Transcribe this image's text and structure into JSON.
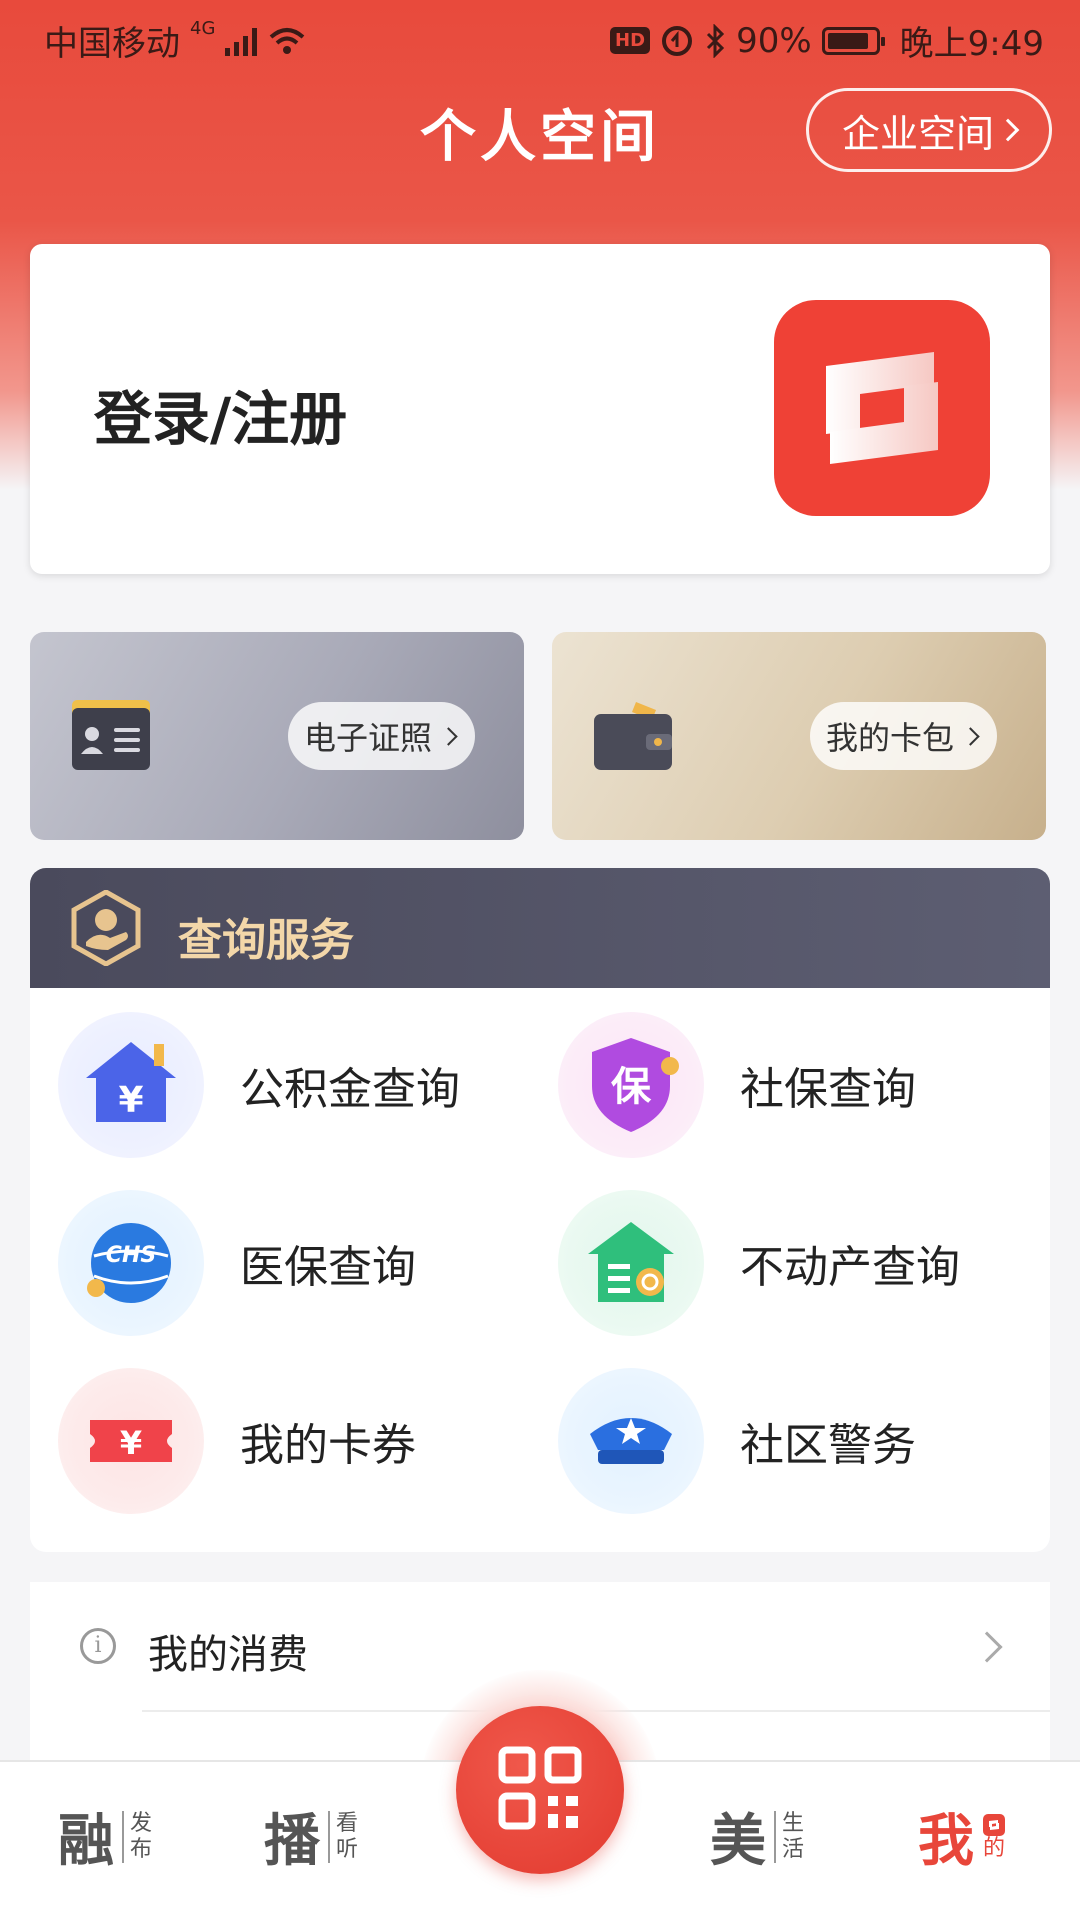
{
  "status_bar": {
    "carrier": "中国移动",
    "network": "4G",
    "battery": "90%",
    "time": "晚上9:49"
  },
  "header": {
    "title": "个人空间",
    "enterprise_button": "企业空间"
  },
  "login": {
    "label": "登录/注册"
  },
  "quick_cards": [
    {
      "label": "电子证照",
      "icon": "id-card-icon"
    },
    {
      "label": "我的卡包",
      "icon": "wallet-icon"
    }
  ],
  "services": {
    "title": "查询服务",
    "items": [
      {
        "label": "公积金查询",
        "icon": "house-yuan-icon"
      },
      {
        "label": "社保查询",
        "icon": "shield-bao-icon",
        "glyph": "保"
      },
      {
        "label": "医保查询",
        "icon": "chs-globe-icon",
        "glyph": "CHS"
      },
      {
        "label": "不动产查询",
        "icon": "property-house-icon"
      },
      {
        "label": "我的卡券",
        "icon": "ticket-yuan-icon",
        "glyph": "¥"
      },
      {
        "label": "社区警务",
        "icon": "police-cap-icon"
      }
    ]
  },
  "list": [
    {
      "label": "我的消费"
    }
  ],
  "tabbar": {
    "tabs": [
      {
        "big": "融",
        "small1": "发",
        "small2": "布"
      },
      {
        "big": "播",
        "small1": "看",
        "small2": "听"
      },
      {
        "big": "美",
        "small1": "生",
        "small2": "活"
      },
      {
        "big": "我",
        "small1": "的"
      }
    ],
    "active": "我",
    "accent": "#e8463a"
  }
}
